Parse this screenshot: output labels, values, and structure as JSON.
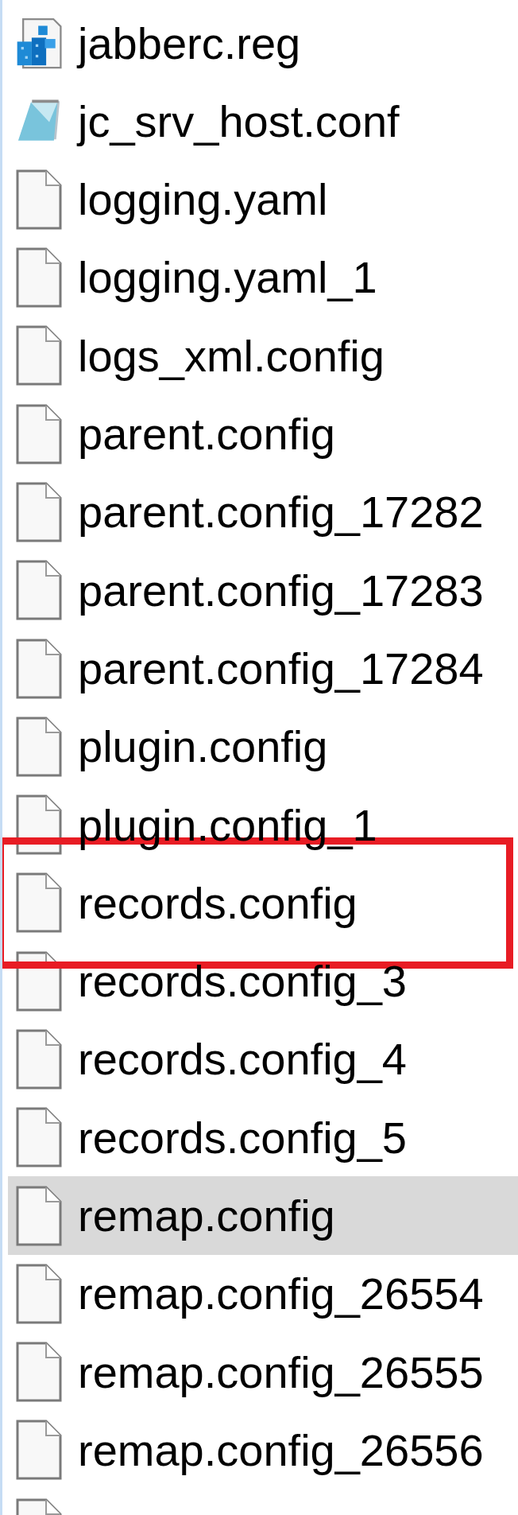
{
  "files": [
    {
      "name": "jabberc.reg",
      "kind": "registry",
      "selected": false,
      "highlighted": false
    },
    {
      "name": "jc_srv_host.conf",
      "kind": "notepad",
      "selected": false,
      "highlighted": false
    },
    {
      "name": "logging.yaml",
      "kind": "file",
      "selected": false,
      "highlighted": false
    },
    {
      "name": "logging.yaml_1",
      "kind": "file",
      "selected": false,
      "highlighted": false
    },
    {
      "name": "logs_xml.config",
      "kind": "file",
      "selected": false,
      "highlighted": false
    },
    {
      "name": "parent.config",
      "kind": "file",
      "selected": false,
      "highlighted": false
    },
    {
      "name": "parent.config_17282",
      "kind": "file",
      "selected": false,
      "highlighted": false
    },
    {
      "name": "parent.config_17283",
      "kind": "file",
      "selected": false,
      "highlighted": false
    },
    {
      "name": "parent.config_17284",
      "kind": "file",
      "selected": false,
      "highlighted": false
    },
    {
      "name": "plugin.config",
      "kind": "file",
      "selected": false,
      "highlighted": false
    },
    {
      "name": "plugin.config_1",
      "kind": "file",
      "selected": false,
      "highlighted": false
    },
    {
      "name": "records.config",
      "kind": "file",
      "selected": false,
      "highlighted": true
    },
    {
      "name": "records.config_3",
      "kind": "file",
      "selected": false,
      "highlighted": false
    },
    {
      "name": "records.config_4",
      "kind": "file",
      "selected": false,
      "highlighted": false
    },
    {
      "name": "records.config_5",
      "kind": "file",
      "selected": false,
      "highlighted": false
    },
    {
      "name": "remap.config",
      "kind": "file",
      "selected": true,
      "highlighted": false
    },
    {
      "name": "remap.config_26554",
      "kind": "file",
      "selected": false,
      "highlighted": false
    },
    {
      "name": "remap.config_26555",
      "kind": "file",
      "selected": false,
      "highlighted": false
    },
    {
      "name": "remap.config_26556",
      "kind": "file",
      "selected": false,
      "highlighted": false
    },
    {
      "kind": "file",
      "selected": false,
      "highlighted": false
    }
  ]
}
